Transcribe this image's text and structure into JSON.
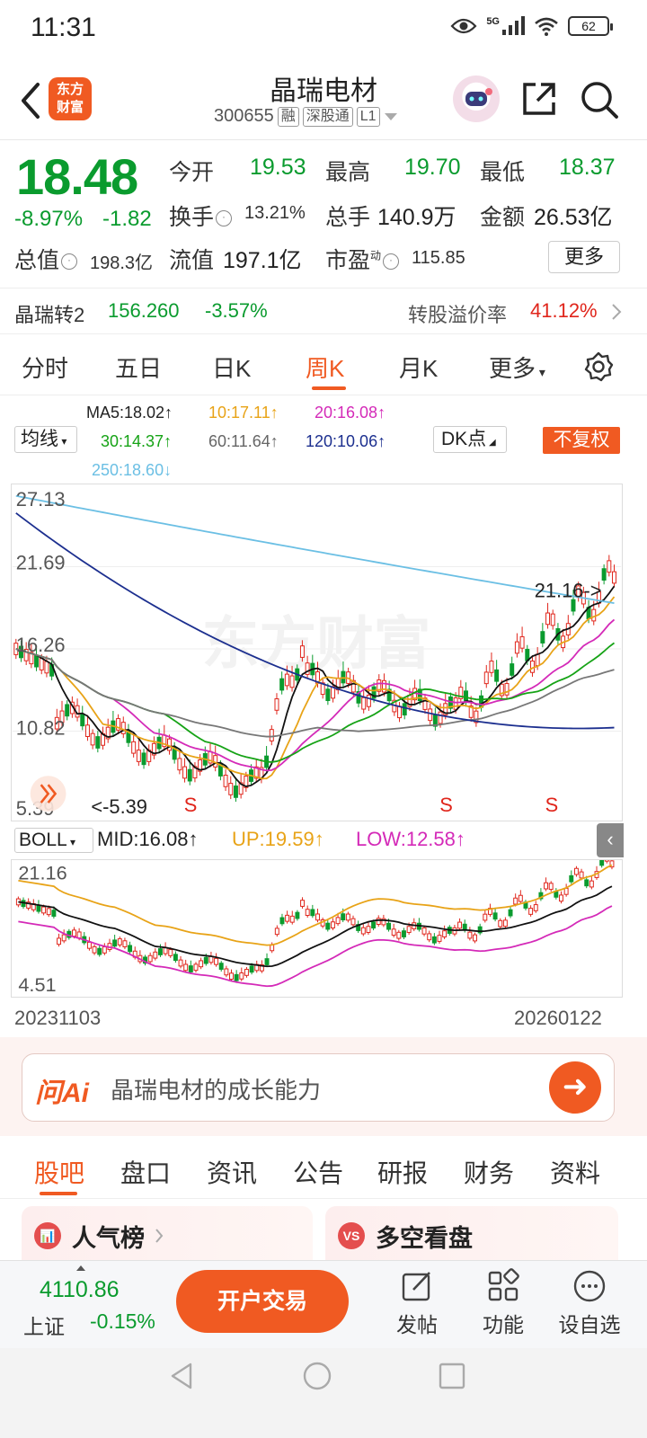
{
  "status": {
    "time": "11:31",
    "network": "5G",
    "battery": "62"
  },
  "header": {
    "logo_line1": "东方",
    "logo_line2": "财富",
    "name": "晶瑞电材",
    "code": "300655",
    "tags": [
      "融",
      "深股通",
      "L1"
    ]
  },
  "quote": {
    "price": "18.48",
    "change_pct": "-8.97%",
    "change_amt": "-1.82",
    "open_label": "今开",
    "open": "19.53",
    "high_label": "最高",
    "high": "19.70",
    "low_label": "最低",
    "low": "18.37",
    "turnover_label": "换手",
    "turnover": "13.21%",
    "volume_label": "总手",
    "volume": "140.9万",
    "amount_label": "金额",
    "amount": "26.53亿",
    "mktcap_label": "总值",
    "mktcap": "198.3亿",
    "float_label": "流值",
    "float": "197.1亿",
    "pe_label": "市盈",
    "pe_sup": "动",
    "pe": "115.85",
    "more_label": "更多"
  },
  "bond": {
    "name": "晶瑞转2",
    "price": "156.260",
    "change": "-3.57%",
    "premium_label": "转股溢价率",
    "premium": "41.12%"
  },
  "period_tabs": [
    "分时",
    "五日",
    "日K",
    "周K",
    "月K",
    "更多"
  ],
  "ma_legend": {
    "select": "均线",
    "ma5": "MA5:18.02↑",
    "ma10": "10:17.11↑",
    "ma20": "20:16.08↑",
    "ma30": "30:14.37↑",
    "ma60": "60:11.64↑",
    "ma120": "120:10.06↑",
    "ma250": "250:18.60↓",
    "dk": "DK点",
    "adjust": "不复权"
  },
  "colors": {
    "ma5": "#111111",
    "ma10": "#e8a317",
    "ma20": "#d42ab8",
    "ma30": "#16a316",
    "ma60": "#777777",
    "ma120": "#1c2f8f",
    "ma250": "#6bbfe4",
    "up": "#e0251b",
    "down": "#0a9b2e",
    "accent": "#f05a22"
  },
  "kline_axis": [
    "27.13",
    "21.69",
    "16.26",
    "10.82",
    "5.39"
  ],
  "kline_annotations": {
    "max_label": "21.16->",
    "min_label": "<-5.39",
    "s_mark": "S"
  },
  "boll": {
    "select": "BOLL",
    "mid": "MID:16.08↑",
    "up": "UP:19.59↑",
    "low": "LOW:12.58↑",
    "axis_top": "21.16",
    "axis_bottom": "4.51"
  },
  "dates": {
    "start": "20231103",
    "end": "20260122"
  },
  "ai": {
    "logo": "问Ai",
    "prompt": "晶瑞电材的成长能力"
  },
  "content_tabs": [
    "股吧",
    "盘口",
    "资讯",
    "公告",
    "研报",
    "财务",
    "资料"
  ],
  "cards": [
    {
      "icon": "📊",
      "title": "人气榜"
    },
    {
      "icon": "VS",
      "title": "多空看盘"
    }
  ],
  "bottom": {
    "index_value": "4110.86",
    "index_name": "上证",
    "index_change": "-0.15%",
    "trade_label": "开户交易",
    "tools": [
      "发帖",
      "功能",
      "设自选"
    ]
  }
}
